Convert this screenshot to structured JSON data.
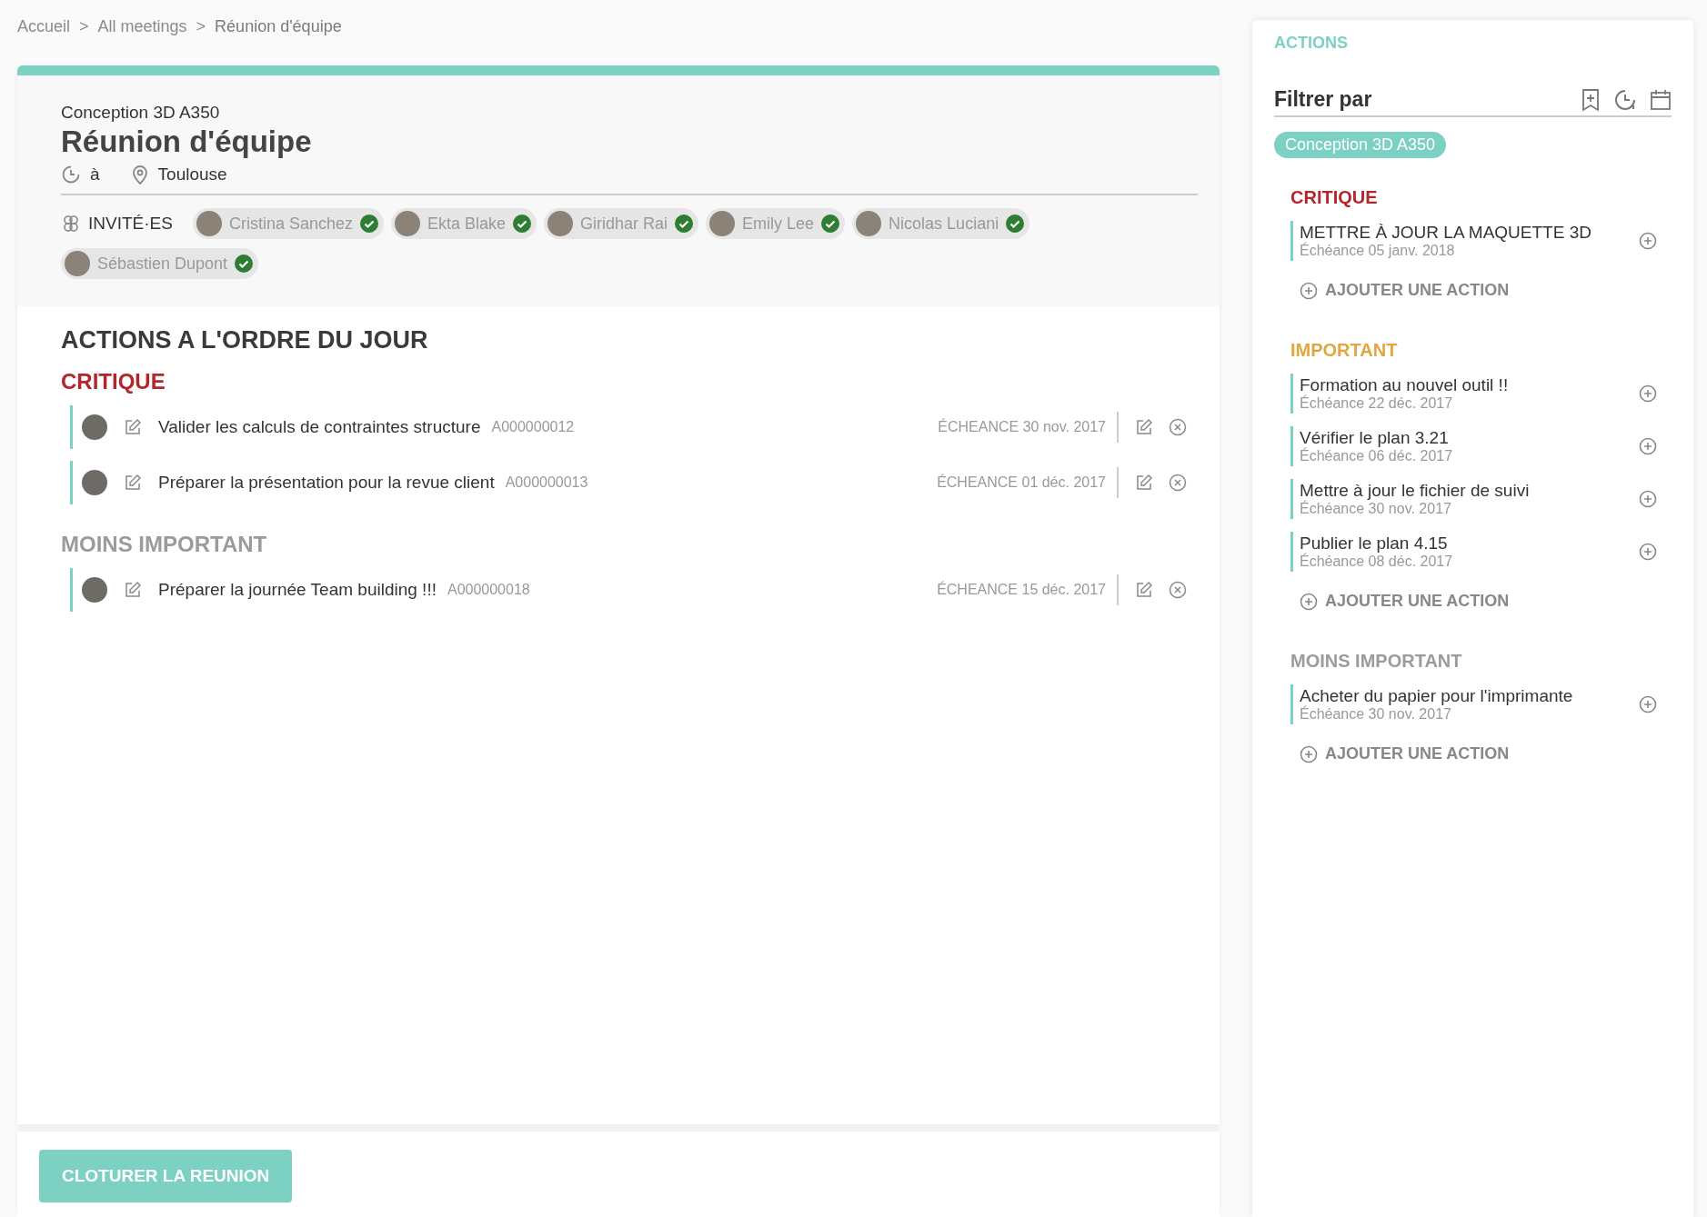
{
  "breadcrumb": [
    {
      "label": "Accueil"
    },
    {
      "separator": ">",
      "label": "All meetings"
    },
    {
      "separator": ">",
      "label": "Réunion d'équipe"
    }
  ],
  "meeting": {
    "project": "Conception 3D A350",
    "title": "Réunion d'équipe",
    "time_prefix": "à",
    "location": "Toulouse",
    "invitees_label": "INVITÉ·ES",
    "invitees": [
      {
        "name": "Cristina Sanchez",
        "confirmed": true
      },
      {
        "name": "Ekta Blake",
        "confirmed": true
      },
      {
        "name": "Giridhar Rai",
        "confirmed": true
      },
      {
        "name": "Emily Lee",
        "confirmed": true
      },
      {
        "name": "Nicolas Luciani",
        "confirmed": true
      },
      {
        "name": "Sébastien Dupont",
        "confirmed": true
      }
    ]
  },
  "agenda": {
    "title": "ACTIONS A L'ORDRE DU JOUR",
    "sections": [
      {
        "name": "CRITIQUE",
        "color": "#b3262b",
        "actions": [
          {
            "title": "Valider les calculs de contraintes structure",
            "ref": "A000000012",
            "due": "ÉCHEANCE 30 nov. 2017"
          },
          {
            "title": "Préparer la présentation pour la revue client",
            "ref": "A000000013",
            "due": "ÉCHEANCE 01 déc. 2017"
          }
        ]
      },
      {
        "name": "MOINS IMPORTANT",
        "color": "#9b9b9b",
        "actions": [
          {
            "title": "Préparer la journée Team building !!!",
            "ref": "A000000018",
            "due": "ÉCHEANCE 15 déc. 2017"
          }
        ]
      }
    ]
  },
  "footer": {
    "button": "CLOTURER LA REUNION"
  },
  "panel": {
    "title": "ACTIONS",
    "filter_label": "Filtrer par",
    "filter_tags": [
      {
        "label": "Conception 3D A350"
      }
    ],
    "sections": [
      {
        "name": "CRITIQUE",
        "color": "#b3262b",
        "add_label": "AJOUTER UNE ACTION",
        "items": [
          {
            "title": "METTRE À JOUR LA MAQUETTE 3D",
            "due": "Échéance 05 janv. 2018"
          }
        ]
      },
      {
        "name": "IMPORTANT",
        "color": "#e0a640",
        "add_label": "AJOUTER UNE ACTION",
        "items": [
          {
            "title": "Formation au nouvel outil !!",
            "due": "Échéance 22 déc. 2017"
          },
          {
            "title": "Vérifier le plan 3.21",
            "due": "Échéance 06 déc. 2017"
          },
          {
            "title": "Mettre à jour le fichier de suivi",
            "due": "Échéance 30 nov. 2017"
          },
          {
            "title": "Publier le plan 4.15",
            "due": "Échéance 08 déc. 2017"
          }
        ]
      },
      {
        "name": "MOINS IMPORTANT",
        "color": "#9b9b9b",
        "add_label": "AJOUTER UNE ACTION",
        "items": [
          {
            "title": "Acheter du papier pour l'imprimante",
            "due": "Échéance 30 nov. 2017"
          }
        ]
      }
    ]
  }
}
